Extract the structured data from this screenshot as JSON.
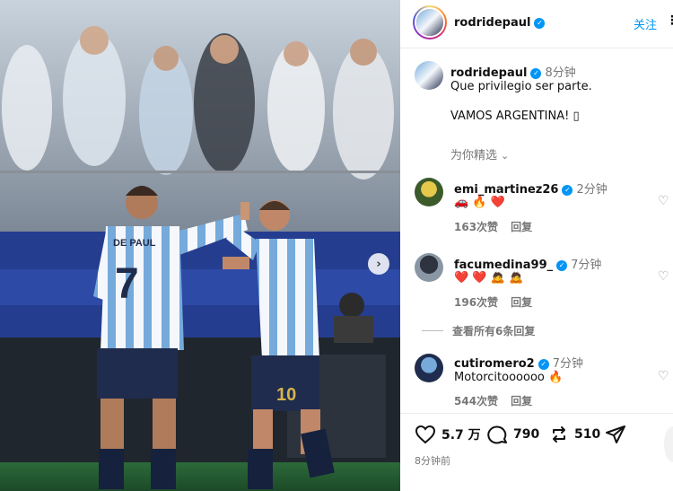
{
  "post": {
    "author": "rodridepaul",
    "verified_mark": "✓",
    "follow_label": "关注",
    "more_label": "⋮",
    "caption_time": "8分钟",
    "caption_line1": "Que privilegio ser parte.",
    "caption_line2": "VAMOS ARGENTINA! ▯",
    "translate_label": "为你精选",
    "translate_chevron": "chevron-down-icon"
  },
  "photo": {
    "jersey_name": "DE PAUL",
    "jersey_number_left": "7",
    "jersey_number_right": "10",
    "next_arrow": "›"
  },
  "comments": [
    {
      "username": "emi_martinez26",
      "time": "2分钟",
      "text": "🚗 🔥 ❤️",
      "likes": "163次赞",
      "reply": "回复"
    },
    {
      "username": "facumedina99_",
      "time": "7分钟",
      "text": "❤️ ❤️ 🙇 🙇",
      "likes": "196次赞",
      "reply": "回复"
    },
    {
      "username": "cutiromero2",
      "time": "7分钟",
      "text": "Motorcitoooooo 🔥",
      "likes": "544次赞",
      "reply": "回复"
    }
  ],
  "view_replies": "查看所有6条回复",
  "actions": {
    "likes": "5.7 万",
    "comments": "790",
    "reposts": "510",
    "posted_ago": "8分钟前"
  },
  "colors": {
    "accent": "#0095f6",
    "argentina_blue": "#75aadb",
    "muted": "#777777"
  }
}
